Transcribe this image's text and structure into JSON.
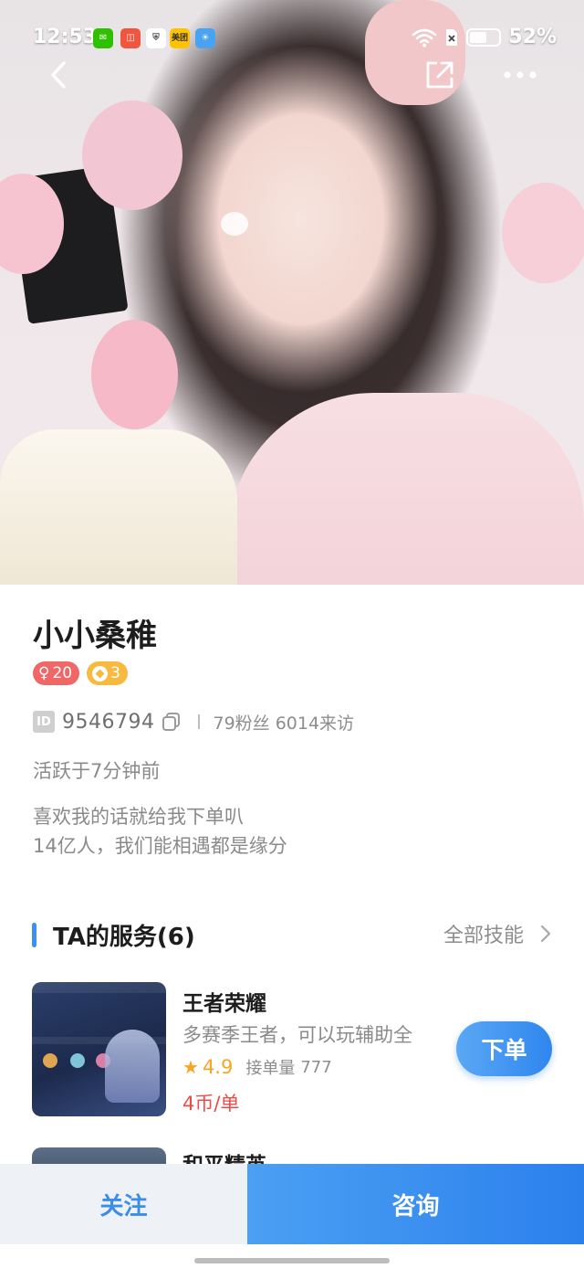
{
  "status_bar": {
    "time": "12:53",
    "battery_percent": "52%",
    "battery_level": 0.52,
    "app_icons": [
      {
        "name": "wechat-icon",
        "color": "#2dc100",
        "glyph": "✉"
      },
      {
        "name": "app-red-icon",
        "color": "#f0553d",
        "glyph": "◫"
      },
      {
        "name": "shield-app-icon",
        "color": "#ffffff",
        "glyph": "⛨"
      },
      {
        "name": "meituan-icon",
        "color": "#ffc300",
        "glyph": "美团"
      },
      {
        "name": "weather-icon",
        "color": "#4aa3f0",
        "glyph": "☀"
      }
    ]
  },
  "profile": {
    "name": "小小桑稚",
    "gender_symbol": "♀",
    "age": "20",
    "level": "3",
    "id_label": "ID",
    "id_number": "9546794",
    "stats": "79粉丝 6014来访",
    "active_status": "活跃于7分钟前",
    "bio_lines": [
      "喜欢我的话就给我下单叭",
      "14亿人，我们能相遇都是缘分"
    ]
  },
  "services_section": {
    "title": "TA的服务(6)",
    "all_link": "全部技能",
    "items": [
      {
        "name": "王者荣耀",
        "description": "多赛季王者，可以玩辅助全",
        "rating": "4.9",
        "orders_label": "接单量",
        "orders_value": "777",
        "price": "4币/单",
        "action_label": "下单"
      },
      {
        "name": "和平精英"
      }
    ]
  },
  "bottom_bar": {
    "follow_label": "关注",
    "consult_label": "咨询"
  },
  "colors": {
    "accent_blue": "#3d8ff0",
    "price_red": "#ee4a46",
    "star_orange": "#f6a623",
    "gender_tag": "#f06767",
    "level_tag": "#f7ba3f"
  }
}
